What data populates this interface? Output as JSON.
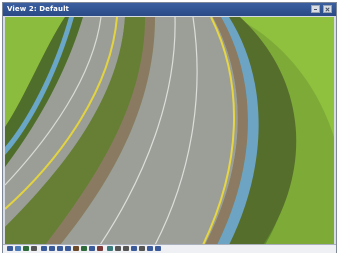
{
  "window": {
    "title": "View 2: Default"
  },
  "colors": {
    "grass": "#5f8a2a",
    "grass_light": "#8bbb3c",
    "asphalt": "#9a9c96",
    "median": "#6d8a36",
    "curb_blue": "#6aa6c8",
    "curb_brown": "#8e7a62",
    "yellow_line": "#e6d641",
    "titlebar": "#2a4a86"
  },
  "toolbar": {
    "tools": [
      {
        "icon": "pointer-icon"
      },
      {
        "icon": "pan-icon"
      },
      {
        "icon": "orbit-icon"
      },
      {
        "icon": "dropdown-icon"
      },
      {
        "icon": "zoom-in-icon"
      },
      {
        "icon": "zoom-out-icon"
      },
      {
        "icon": "zoom-window-icon"
      },
      {
        "icon": "zoom-extents-icon"
      },
      {
        "icon": "fly-icon"
      },
      {
        "icon": "walk-icon"
      },
      {
        "icon": "look-icon"
      },
      {
        "icon": "section-icon"
      },
      {
        "icon": "render-icon"
      },
      {
        "icon": "select-icon"
      },
      {
        "icon": "measure-icon"
      },
      {
        "icon": "camera-icon"
      },
      {
        "icon": "settings-icon"
      },
      {
        "icon": "zoom-icon"
      },
      {
        "icon": "search-icon"
      }
    ]
  }
}
